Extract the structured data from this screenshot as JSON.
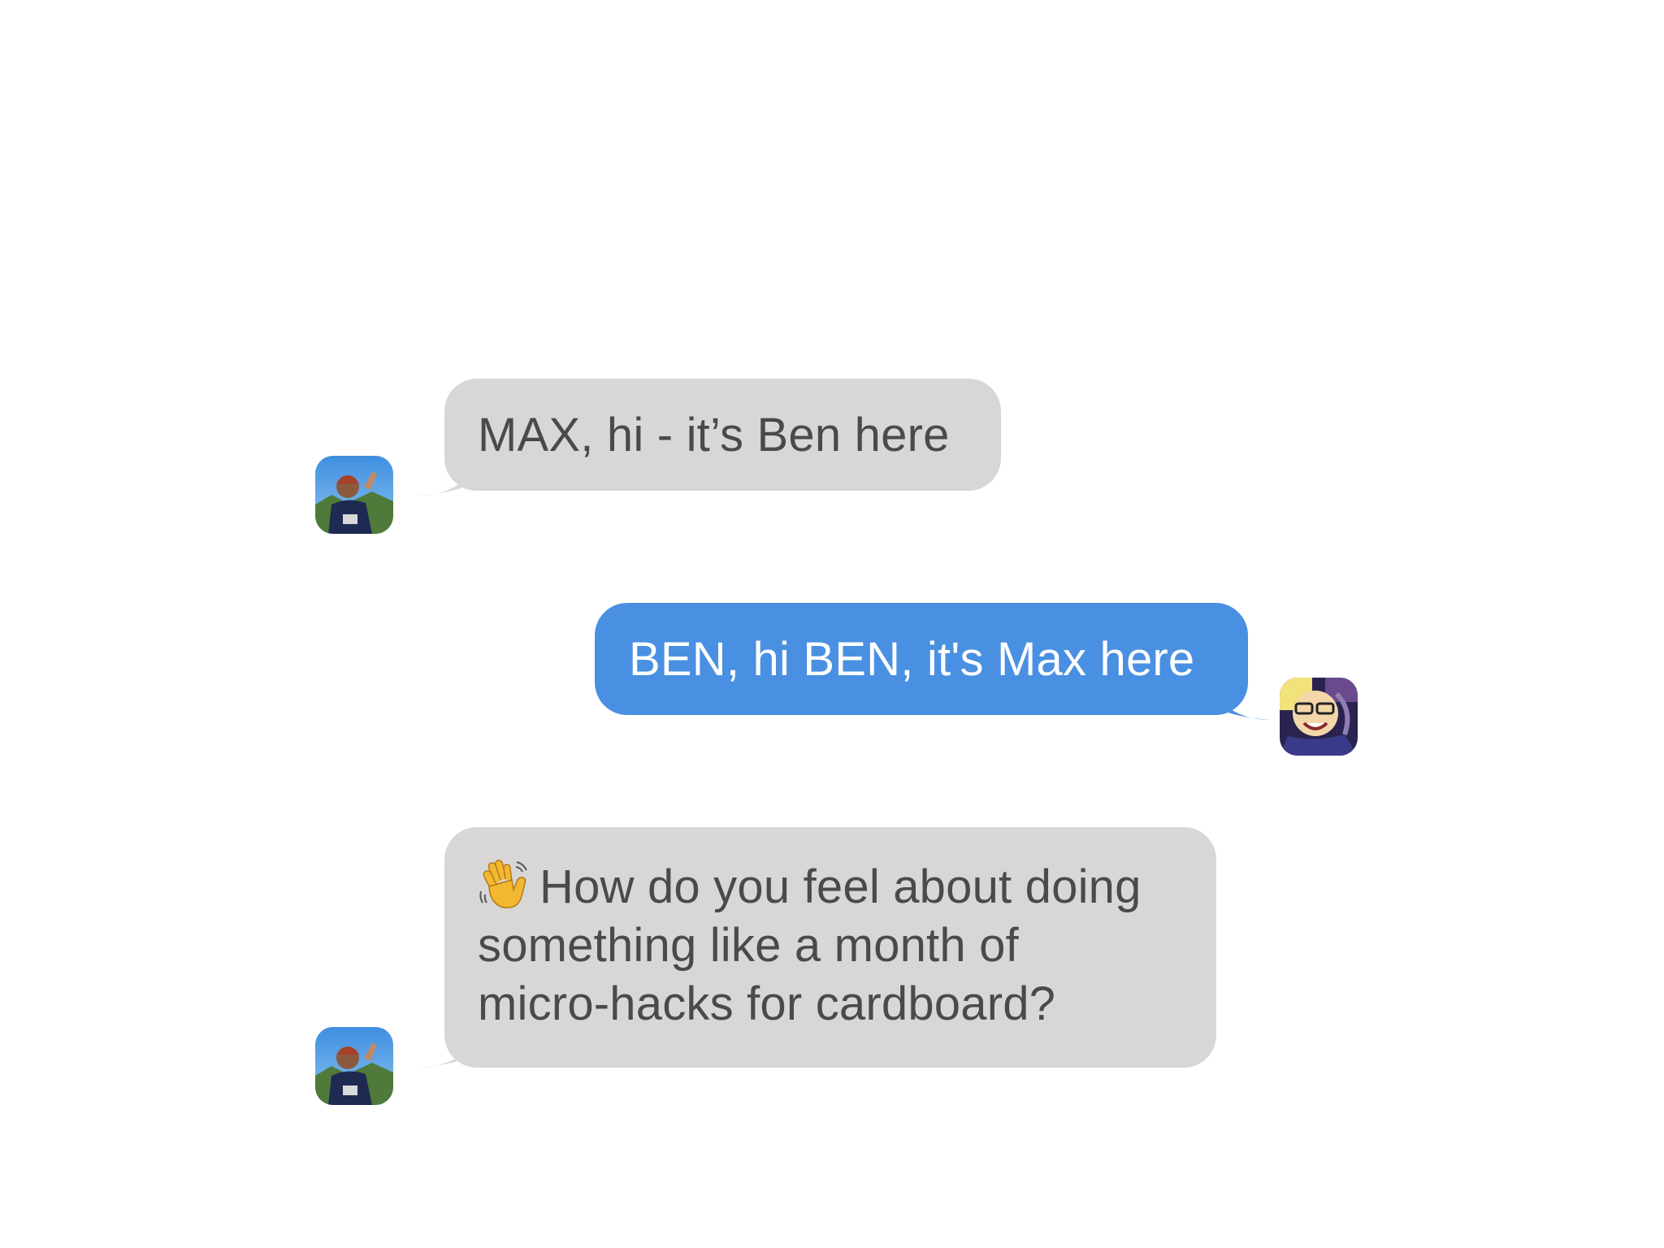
{
  "conversation": {
    "messages": [
      {
        "sender": "Ben",
        "direction": "incoming",
        "text": "MAX, hi - it’s Ben here"
      },
      {
        "sender": "Max",
        "direction": "outgoing",
        "text": "BEN, hi BEN, it's Max here"
      },
      {
        "sender": "Ben",
        "direction": "incoming",
        "emoji": "waving-hand-icon",
        "lines": [
          "How do you feel about doing",
          "something like a month of",
          "micro-hacks for cardboard?"
        ]
      }
    ]
  },
  "colors": {
    "incoming_bubble": "#d8d7d6",
    "incoming_text": "#4a4a4a",
    "outgoing_bubble": "#4a90e2",
    "outgoing_text": "#ffffff"
  }
}
